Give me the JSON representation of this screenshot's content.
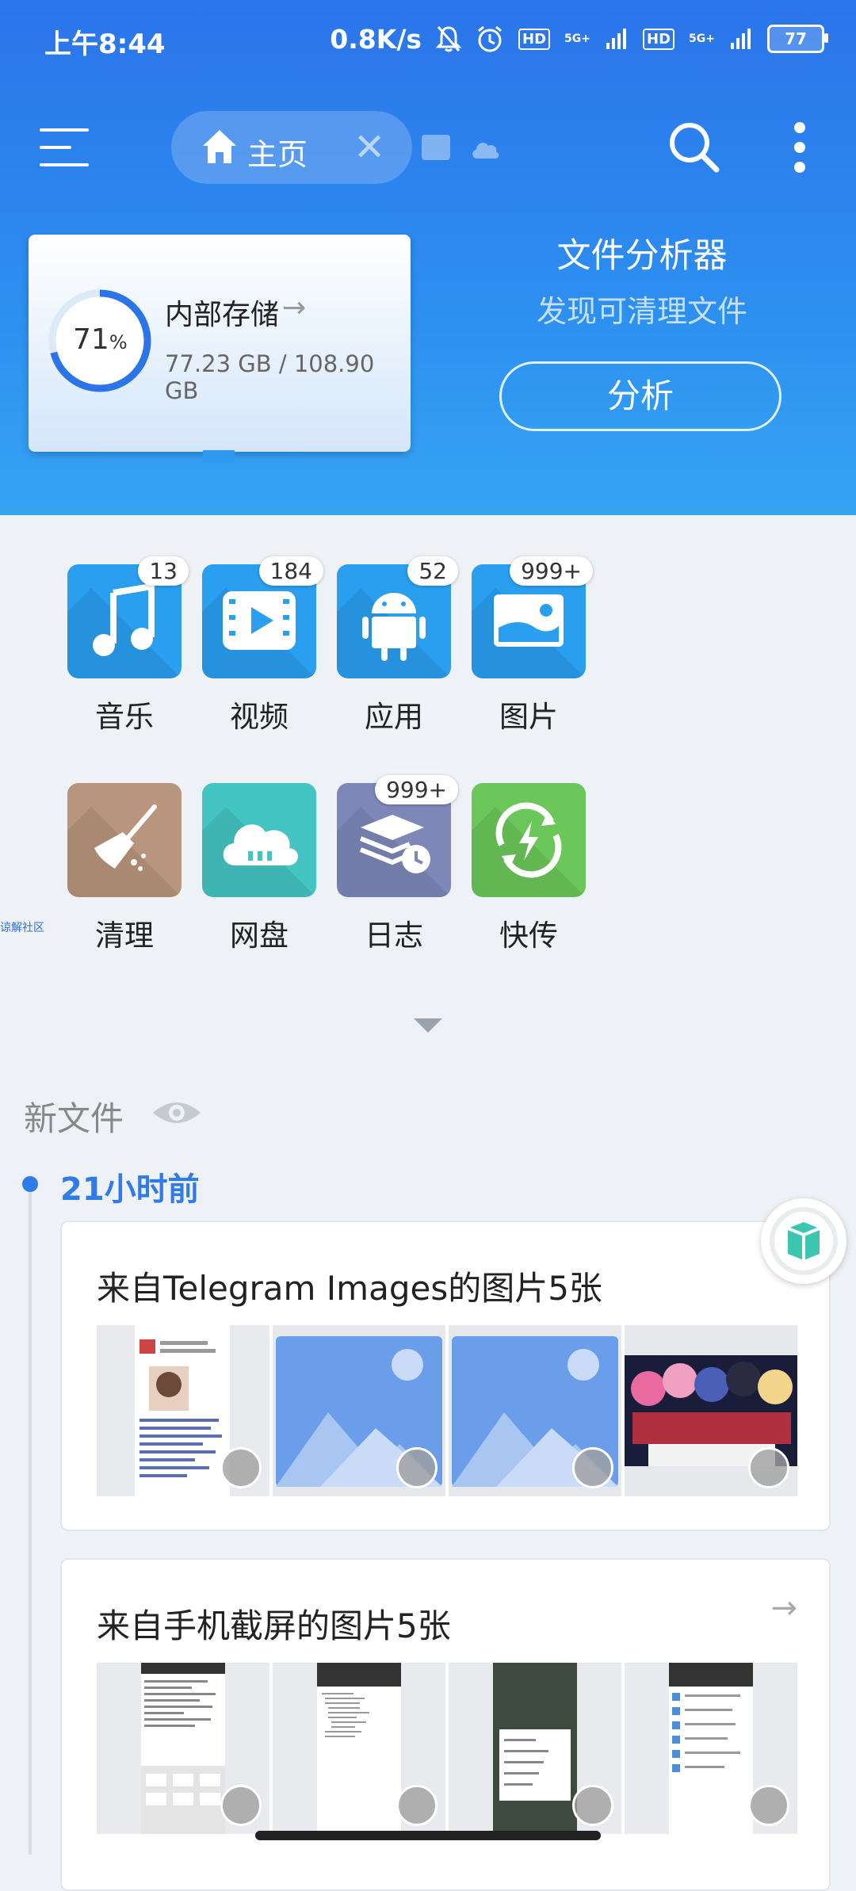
{
  "status": {
    "time": "上午8:44",
    "net_speed": "0.8K/s",
    "hd1": "HD",
    "sig1": "5G+",
    "hd2": "HD",
    "sig2": "5G+",
    "battery": "77"
  },
  "toolbar": {
    "home_tab_label": "主页",
    "close_glyph": "✕"
  },
  "storage": {
    "percent": "71",
    "percent_unit": "%",
    "percent_value": 0.71,
    "title": "内部存储",
    "arrow": "→",
    "size": "77.23 GB / 108.90 GB"
  },
  "analyzer": {
    "title": "文件分析器",
    "subtitle": "发现可清理文件",
    "button": "分析"
  },
  "categories": [
    {
      "label": "音乐",
      "badge": "13",
      "color": "#2a9ff0",
      "icon": "music-icon"
    },
    {
      "label": "视频",
      "badge": "184",
      "color": "#2a9ff0",
      "icon": "video-icon"
    },
    {
      "label": "应用",
      "badge": "52",
      "color": "#2a9ff0",
      "icon": "android-icon"
    },
    {
      "label": "图片",
      "badge": "999+",
      "color": "#2a9ff0",
      "icon": "image-icon"
    },
    {
      "label": "清理",
      "badge": "",
      "color": "#b8957c",
      "icon": "broom-icon"
    },
    {
      "label": "网盘",
      "badge": "",
      "color": "#44c5c3",
      "icon": "cloud-drive-icon"
    },
    {
      "label": "日志",
      "badge": "999+",
      "color": "#7d88b8",
      "icon": "log-icon"
    },
    {
      "label": "快传",
      "badge": "",
      "color": "#6bc75a",
      "icon": "transfer-icon"
    }
  ],
  "side_tag": "谅解社区",
  "new_files": {
    "title": "新文件",
    "time_label": "21小时前",
    "cards": [
      {
        "title": "来自Telegram Images的图片5张"
      },
      {
        "title": "来自手机截屏的图片5张",
        "arrow": "→"
      }
    ]
  }
}
